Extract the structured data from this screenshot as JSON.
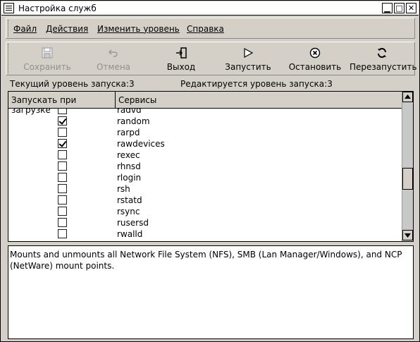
{
  "window": {
    "title": "Настройка служб"
  },
  "menu": {
    "file": "Файл",
    "actions": "Действия",
    "change_level": "Изменить уровень",
    "help": "Справка"
  },
  "toolbar": {
    "save": "Сохранить",
    "cancel": "Отмена",
    "exit": "Выход",
    "start": "Запустить",
    "stop": "Остановить",
    "restart": "Перезапустить"
  },
  "status": {
    "current_level": "Текущий уровень запуска:3",
    "editing_level": "Редактируется уровень запуска:3"
  },
  "table": {
    "col_start_on_boot": "Запускать при загрузке",
    "col_services": "Сервисы",
    "rows": [
      {
        "name": "radvd",
        "checked": false
      },
      {
        "name": "random",
        "checked": true
      },
      {
        "name": "rarpd",
        "checked": false
      },
      {
        "name": "rawdevices",
        "checked": true
      },
      {
        "name": "rexec",
        "checked": false
      },
      {
        "name": "rhnsd",
        "checked": false
      },
      {
        "name": "rlogin",
        "checked": false
      },
      {
        "name": "rsh",
        "checked": false
      },
      {
        "name": "rstatd",
        "checked": false
      },
      {
        "name": "rsync",
        "checked": false
      },
      {
        "name": "rusersd",
        "checked": false
      },
      {
        "name": "rwalld",
        "checked": false
      }
    ]
  },
  "description": "Mounts and unmounts all Network File System (NFS), SMB (Lan Manager/Windows), and NCP (NetWare) mount points."
}
